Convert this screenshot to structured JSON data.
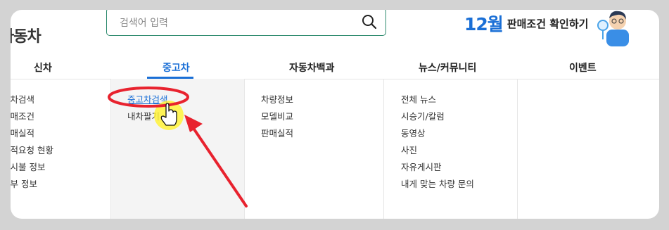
{
  "header": {
    "logo_text": "자동차",
    "search_placeholder": "검색어 입력",
    "promo_month": "12월",
    "promo_text": "판매조건 확인하기"
  },
  "tabs": [
    "신차",
    "중고차",
    "자동차백과",
    "뉴스/커뮤니티",
    "이벤트"
  ],
  "menus": {
    "new_car": [
      "신차검색",
      "판매조건",
      "판매실적",
      "견적요청 현황",
      "실시불 정보",
      "할부 정보"
    ],
    "used_car": [
      "중고차검색",
      "내차팔기"
    ],
    "encyclopedia": [
      "차량정보",
      "모델비교",
      "판매실적"
    ],
    "news": [
      "전체 뉴스",
      "시승기/칼럼",
      "동영상",
      "사진",
      "자유게시판",
      "내게 맞는 차량 문의"
    ]
  },
  "colors": {
    "accent": "#1a6fd6",
    "annotation": "#e8222e",
    "highlight": "#fff23a"
  }
}
